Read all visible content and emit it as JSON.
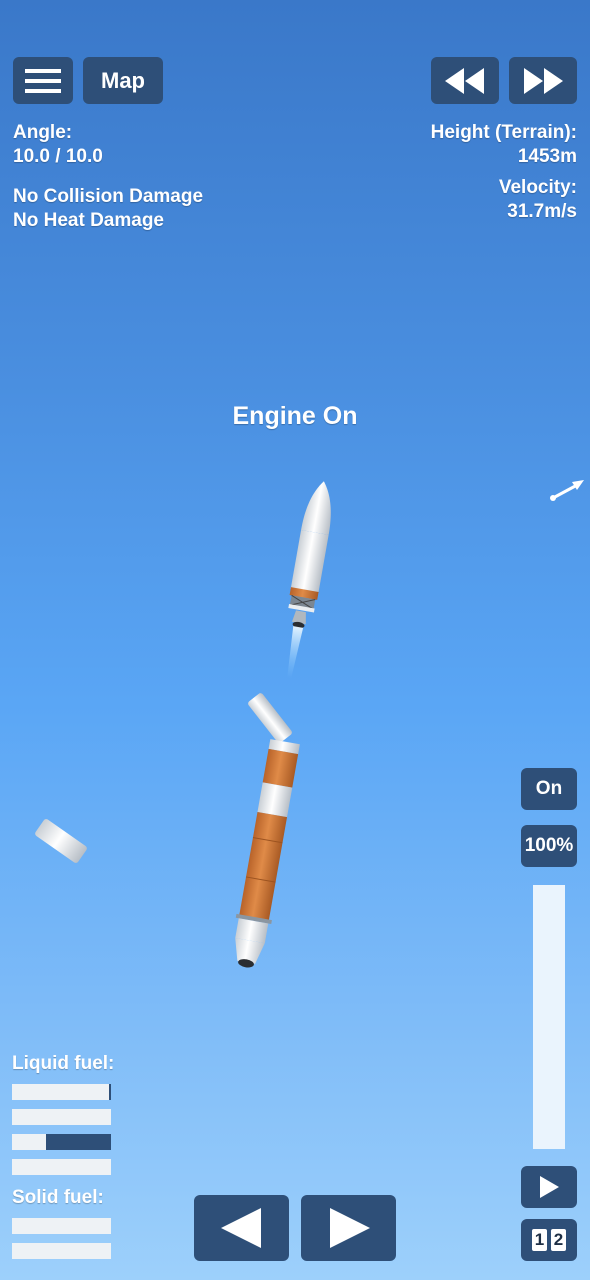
{
  "topbar": {
    "map_label": "Map",
    "menu_icon": "menu-icon",
    "rewind_icon": "rewind-icon",
    "fast_forward_icon": "fast-forward-icon"
  },
  "info_left": {
    "angle_label": "Angle:",
    "angle_value": "10.0 / 10.0",
    "collision": "No Collision Damage",
    "heat": "No Heat Damage"
  },
  "info_right": {
    "height_label": "Height (Terrain):",
    "height_value": "1453m",
    "velocity_label": "Velocity:",
    "velocity_value": "31.7m/s"
  },
  "status_message": "Engine On",
  "controls": {
    "engine_toggle_label": "On",
    "throttle_label": "100%",
    "throttle_fraction": 1.0,
    "play_icon": "play-icon",
    "stage_1": "1",
    "stage_2": "2"
  },
  "fuel": {
    "liquid_label": "Liquid fuel:",
    "liquid_levels": [
      0.02,
      0.0,
      0.66,
      0.0
    ],
    "solid_label": "Solid fuel:",
    "solid_levels": [
      0.0,
      0.0
    ]
  },
  "colors": {
    "button_bg": "#2e4f78",
    "booster_orange": "#d07a38",
    "bar_bg": "#eef2f5"
  }
}
